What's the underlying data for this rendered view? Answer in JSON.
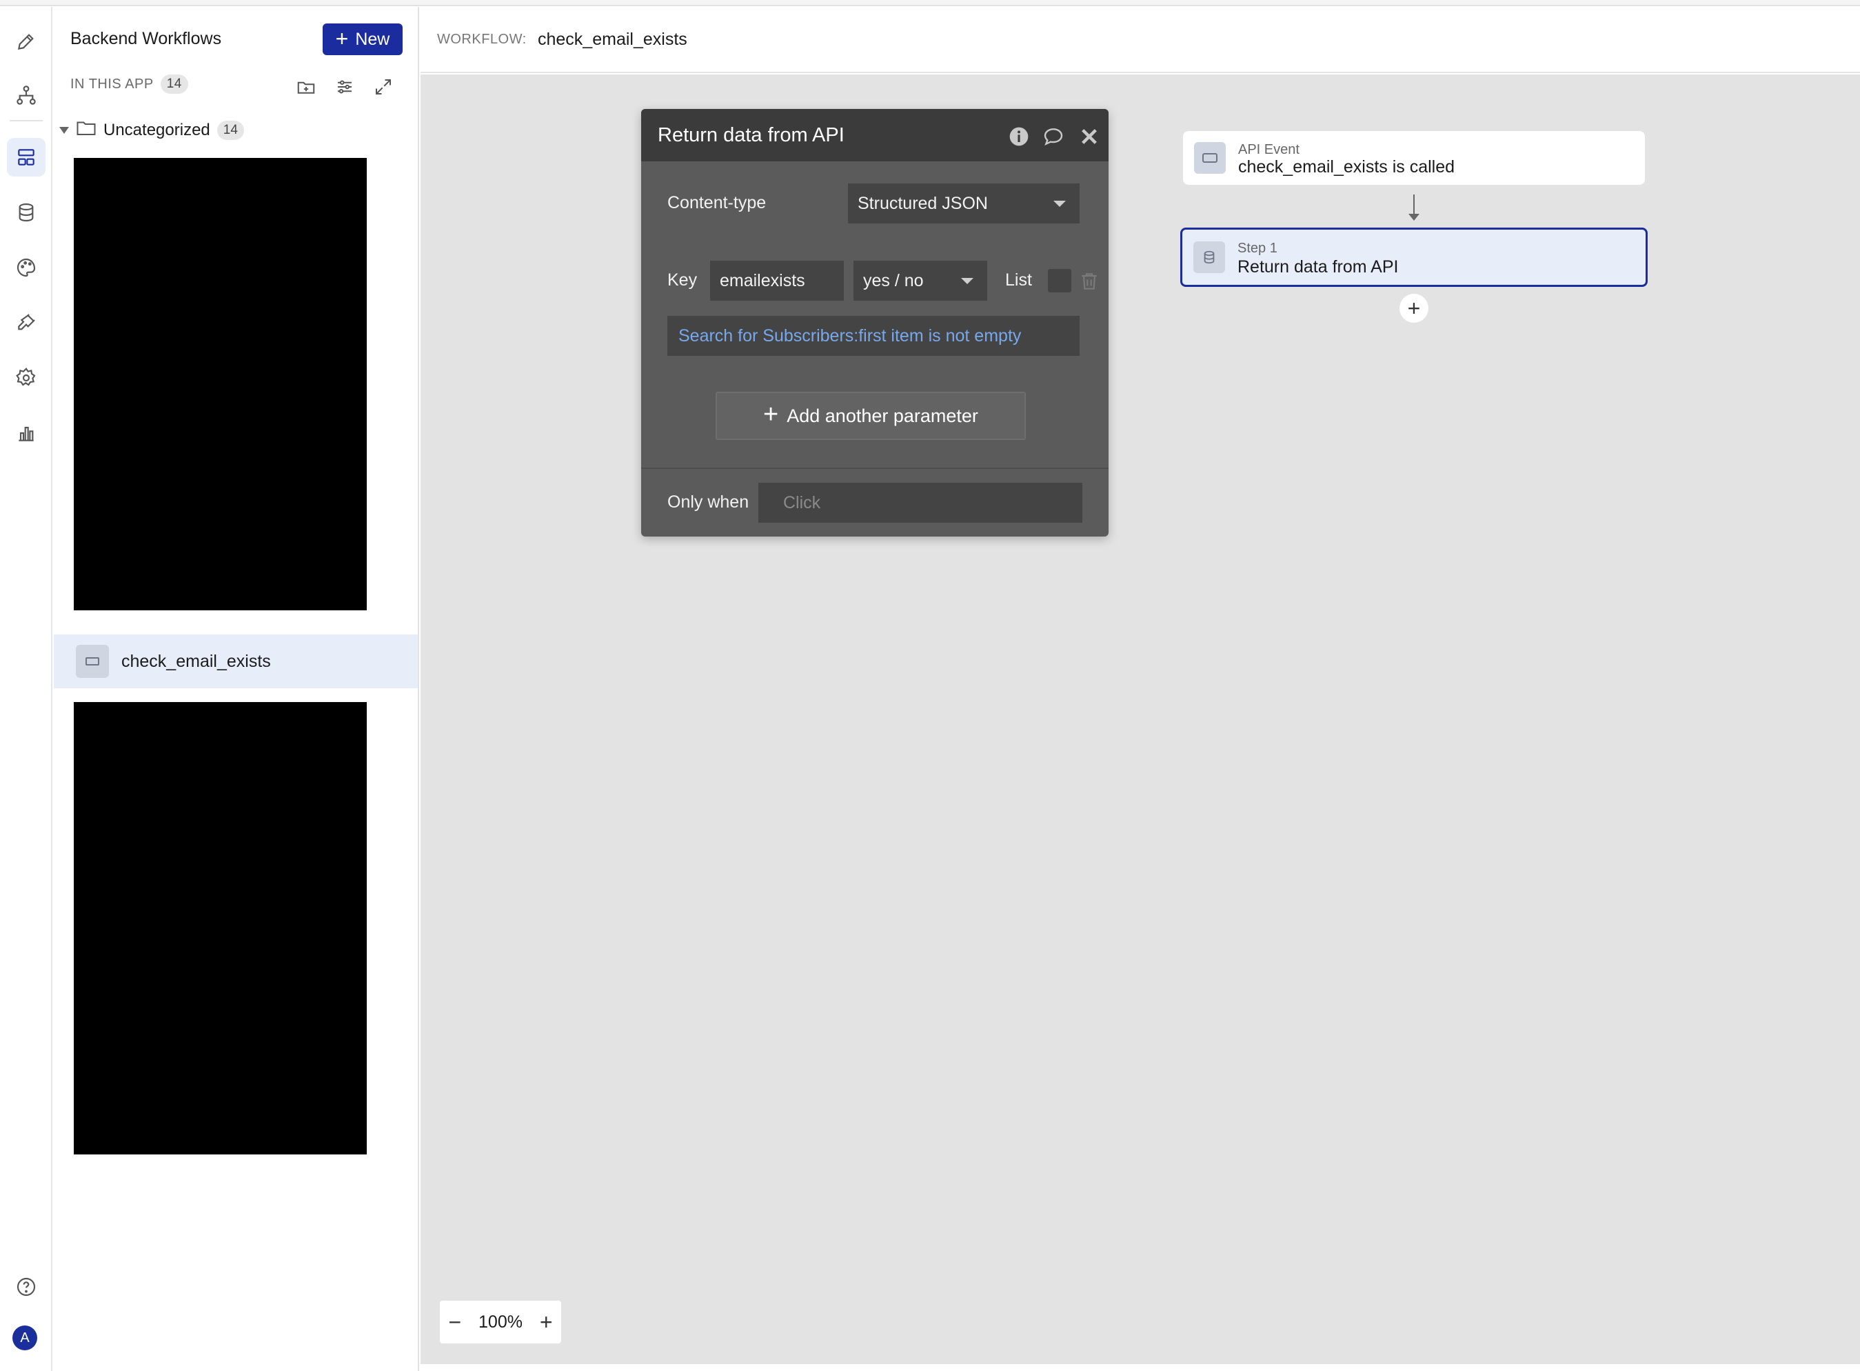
{
  "sidebar": {
    "title": "Backend Workflows",
    "new_label": "New",
    "section_label": "IN THIS APP",
    "section_count": "14",
    "folder_name": "Uncategorized",
    "folder_count": "14",
    "workflow_item": "check_email_exists"
  },
  "header": {
    "label": "WORKFLOW:",
    "workflow_name": "check_email_exists"
  },
  "dialog": {
    "title": "Return data from API",
    "content_type_label": "Content-type",
    "content_type_value": "Structured JSON",
    "key_label": "Key",
    "key_value": "emailexists",
    "type_value": "yes / no",
    "list_label": "List",
    "expression": "Search for Subscribers:first item is not empty",
    "add_param_label": "Add another parameter",
    "only_when_label": "Only when",
    "only_when_placeholder": "Click"
  },
  "flow": {
    "event_small": "API Event",
    "event_big": "check_email_exists is called",
    "step_small": "Step 1",
    "step_big": "Return data from API"
  },
  "zoom": {
    "level": "100%"
  },
  "user": {
    "avatar_letter": "A"
  },
  "colors": {
    "brand": "#1b2c9e",
    "selection_bg": "#e8eef9",
    "dialog_bg": "#5b5b5b",
    "expression_text": "#78a8ec"
  },
  "icons": [
    "pencil-icon",
    "hierarchy-icon",
    "workflows-icon",
    "database-icon",
    "palette-icon",
    "plugin-icon",
    "settings-icon",
    "chart-icon",
    "help-icon",
    "info-icon",
    "comment-icon",
    "close-icon",
    "trash-icon",
    "folder-icon",
    "new-folder-icon",
    "filter-icon",
    "expand-icon"
  ]
}
